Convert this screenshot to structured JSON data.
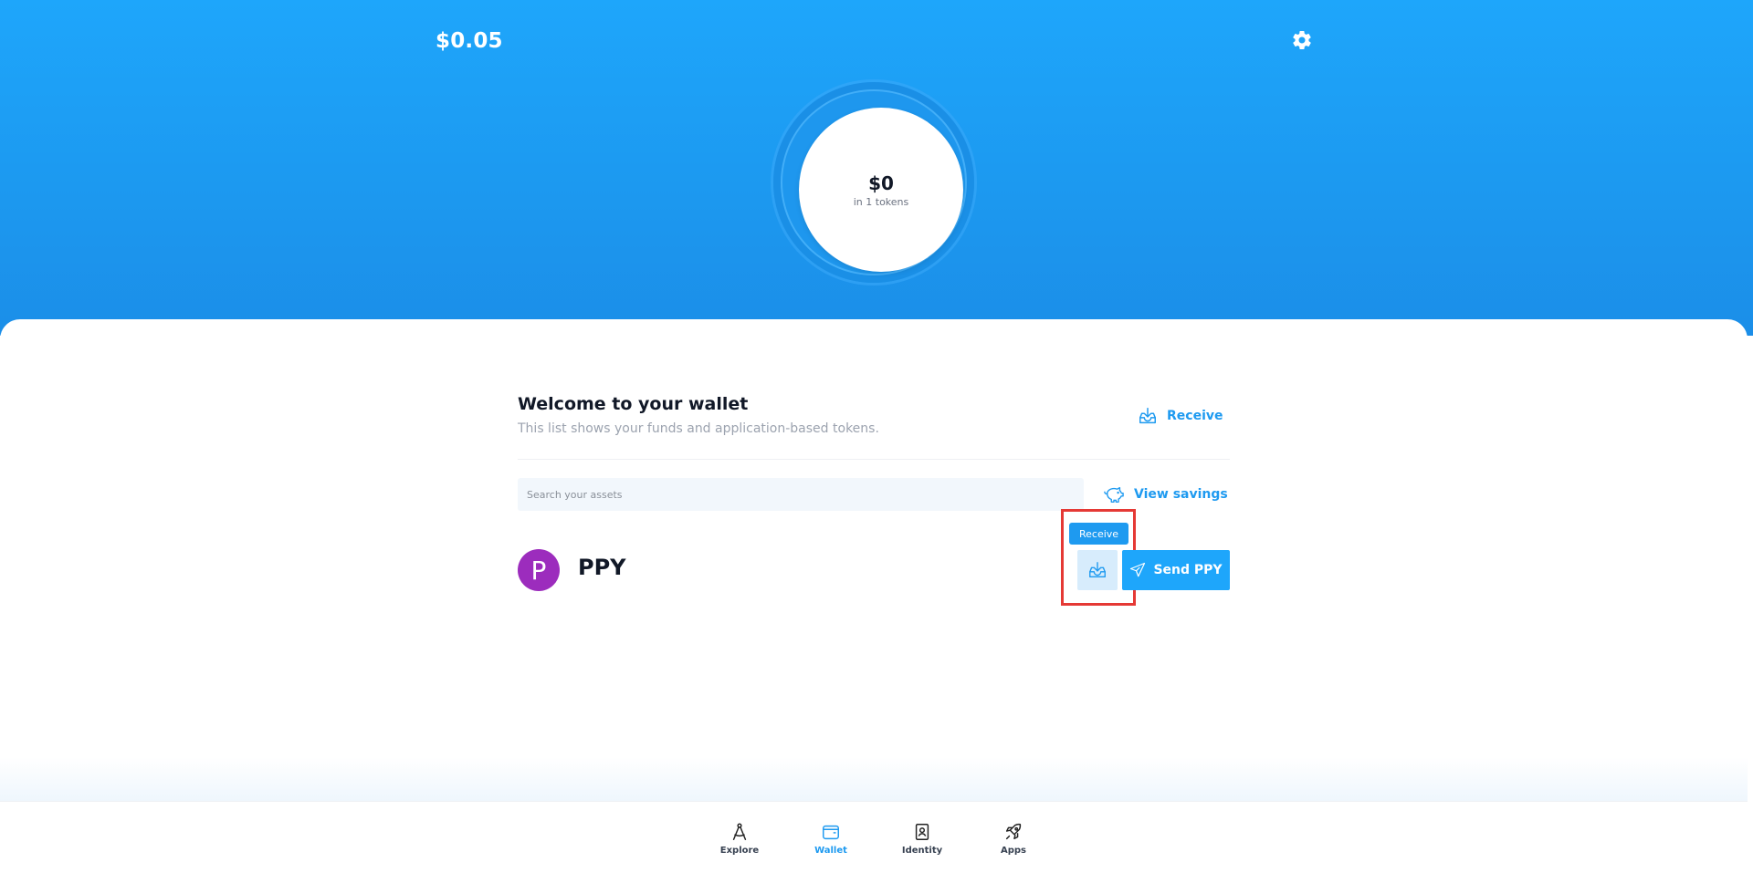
{
  "hero": {
    "balance": "$0.05",
    "total_value": "$0",
    "token_count": "in 1 tokens"
  },
  "welcome": {
    "title": "Welcome to your wallet",
    "subtitle": "This list shows your funds and application-based tokens.",
    "receive_label": "Receive"
  },
  "search": {
    "placeholder": "Search your assets",
    "value": ""
  },
  "savings": {
    "label": "View savings"
  },
  "token": {
    "avatar_letter": "P",
    "symbol": "PPY",
    "tooltip": "Receive",
    "send_label": "Send PPY",
    "avatar_color": "#9c2cbd"
  },
  "nav": {
    "items": [
      {
        "label": "Explore",
        "icon": "compass-icon"
      },
      {
        "label": "Wallet",
        "icon": "wallet-icon",
        "active": true
      },
      {
        "label": "Identity",
        "icon": "id-card-icon"
      },
      {
        "label": "Apps",
        "icon": "rocket-icon"
      }
    ]
  },
  "colors": {
    "accent": "#1e9af0",
    "hero": "#1ea6fb",
    "highlight": "#e53935"
  }
}
